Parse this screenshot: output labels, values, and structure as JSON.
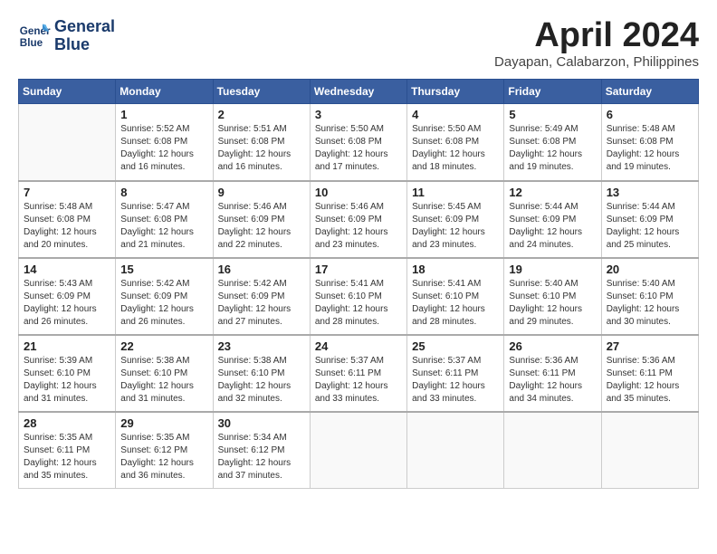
{
  "header": {
    "logo_line1": "General",
    "logo_line2": "Blue",
    "month_title": "April 2024",
    "location": "Dayapan, Calabarzon, Philippines"
  },
  "weekdays": [
    "Sunday",
    "Monday",
    "Tuesday",
    "Wednesday",
    "Thursday",
    "Friday",
    "Saturday"
  ],
  "weeks": [
    [
      {
        "day": "",
        "info": ""
      },
      {
        "day": "1",
        "info": "Sunrise: 5:52 AM\nSunset: 6:08 PM\nDaylight: 12 hours\nand 16 minutes."
      },
      {
        "day": "2",
        "info": "Sunrise: 5:51 AM\nSunset: 6:08 PM\nDaylight: 12 hours\nand 16 minutes."
      },
      {
        "day": "3",
        "info": "Sunrise: 5:50 AM\nSunset: 6:08 PM\nDaylight: 12 hours\nand 17 minutes."
      },
      {
        "day": "4",
        "info": "Sunrise: 5:50 AM\nSunset: 6:08 PM\nDaylight: 12 hours\nand 18 minutes."
      },
      {
        "day": "5",
        "info": "Sunrise: 5:49 AM\nSunset: 6:08 PM\nDaylight: 12 hours\nand 19 minutes."
      },
      {
        "day": "6",
        "info": "Sunrise: 5:48 AM\nSunset: 6:08 PM\nDaylight: 12 hours\nand 19 minutes."
      }
    ],
    [
      {
        "day": "7",
        "info": "Sunrise: 5:48 AM\nSunset: 6:08 PM\nDaylight: 12 hours\nand 20 minutes."
      },
      {
        "day": "8",
        "info": "Sunrise: 5:47 AM\nSunset: 6:08 PM\nDaylight: 12 hours\nand 21 minutes."
      },
      {
        "day": "9",
        "info": "Sunrise: 5:46 AM\nSunset: 6:09 PM\nDaylight: 12 hours\nand 22 minutes."
      },
      {
        "day": "10",
        "info": "Sunrise: 5:46 AM\nSunset: 6:09 PM\nDaylight: 12 hours\nand 23 minutes."
      },
      {
        "day": "11",
        "info": "Sunrise: 5:45 AM\nSunset: 6:09 PM\nDaylight: 12 hours\nand 23 minutes."
      },
      {
        "day": "12",
        "info": "Sunrise: 5:44 AM\nSunset: 6:09 PM\nDaylight: 12 hours\nand 24 minutes."
      },
      {
        "day": "13",
        "info": "Sunrise: 5:44 AM\nSunset: 6:09 PM\nDaylight: 12 hours\nand 25 minutes."
      }
    ],
    [
      {
        "day": "14",
        "info": "Sunrise: 5:43 AM\nSunset: 6:09 PM\nDaylight: 12 hours\nand 26 minutes."
      },
      {
        "day": "15",
        "info": "Sunrise: 5:42 AM\nSunset: 6:09 PM\nDaylight: 12 hours\nand 26 minutes."
      },
      {
        "day": "16",
        "info": "Sunrise: 5:42 AM\nSunset: 6:09 PM\nDaylight: 12 hours\nand 27 minutes."
      },
      {
        "day": "17",
        "info": "Sunrise: 5:41 AM\nSunset: 6:10 PM\nDaylight: 12 hours\nand 28 minutes."
      },
      {
        "day": "18",
        "info": "Sunrise: 5:41 AM\nSunset: 6:10 PM\nDaylight: 12 hours\nand 28 minutes."
      },
      {
        "day": "19",
        "info": "Sunrise: 5:40 AM\nSunset: 6:10 PM\nDaylight: 12 hours\nand 29 minutes."
      },
      {
        "day": "20",
        "info": "Sunrise: 5:40 AM\nSunset: 6:10 PM\nDaylight: 12 hours\nand 30 minutes."
      }
    ],
    [
      {
        "day": "21",
        "info": "Sunrise: 5:39 AM\nSunset: 6:10 PM\nDaylight: 12 hours\nand 31 minutes."
      },
      {
        "day": "22",
        "info": "Sunrise: 5:38 AM\nSunset: 6:10 PM\nDaylight: 12 hours\nand 31 minutes."
      },
      {
        "day": "23",
        "info": "Sunrise: 5:38 AM\nSunset: 6:10 PM\nDaylight: 12 hours\nand 32 minutes."
      },
      {
        "day": "24",
        "info": "Sunrise: 5:37 AM\nSunset: 6:11 PM\nDaylight: 12 hours\nand 33 minutes."
      },
      {
        "day": "25",
        "info": "Sunrise: 5:37 AM\nSunset: 6:11 PM\nDaylight: 12 hours\nand 33 minutes."
      },
      {
        "day": "26",
        "info": "Sunrise: 5:36 AM\nSunset: 6:11 PM\nDaylight: 12 hours\nand 34 minutes."
      },
      {
        "day": "27",
        "info": "Sunrise: 5:36 AM\nSunset: 6:11 PM\nDaylight: 12 hours\nand 35 minutes."
      }
    ],
    [
      {
        "day": "28",
        "info": "Sunrise: 5:35 AM\nSunset: 6:11 PM\nDaylight: 12 hours\nand 35 minutes."
      },
      {
        "day": "29",
        "info": "Sunrise: 5:35 AM\nSunset: 6:12 PM\nDaylight: 12 hours\nand 36 minutes."
      },
      {
        "day": "30",
        "info": "Sunrise: 5:34 AM\nSunset: 6:12 PM\nDaylight: 12 hours\nand 37 minutes."
      },
      {
        "day": "",
        "info": ""
      },
      {
        "day": "",
        "info": ""
      },
      {
        "day": "",
        "info": ""
      },
      {
        "day": "",
        "info": ""
      }
    ]
  ]
}
